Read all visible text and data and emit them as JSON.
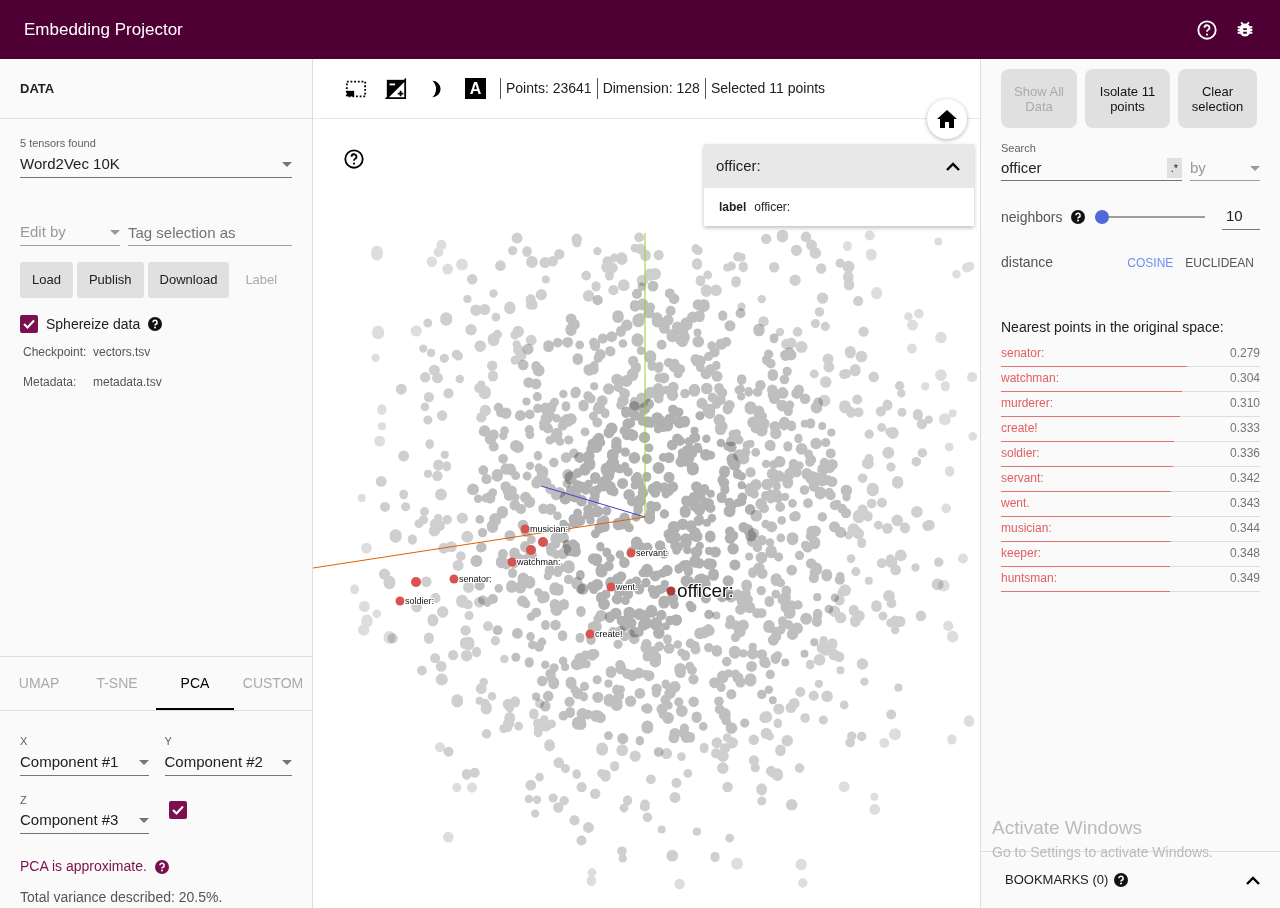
{
  "app": {
    "title": "Embedding Projector"
  },
  "data_panel": {
    "heading": "DATA",
    "tensor_select": {
      "label": "5 tensors found",
      "value": "Word2Vec 10K"
    },
    "edit_by": {
      "placeholder": "Edit by"
    },
    "tag_field": {
      "placeholder": "Tag selection as"
    },
    "buttons": [
      {
        "label": "Load",
        "disabled": false
      },
      {
        "label": "Publish",
        "disabled": false
      },
      {
        "label": "Download",
        "disabled": false
      },
      {
        "label": "Label",
        "disabled": true
      }
    ],
    "sphereize": {
      "label": "Sphereize data",
      "checked": true
    },
    "files": [
      {
        "key": "Checkpoint:",
        "value": "vectors.tsv"
      },
      {
        "key": "Metadata:",
        "value": "metadata.tsv"
      }
    ]
  },
  "projection_tabs": [
    {
      "label": "UMAP",
      "selected": false
    },
    {
      "label": "T-SNE",
      "selected": false
    },
    {
      "label": "PCA",
      "selected": true
    },
    {
      "label": "CUSTOM",
      "selected": false
    }
  ],
  "pca": {
    "x": {
      "label": "X",
      "value": "Component #1"
    },
    "y": {
      "label": "Y",
      "value": "Component #2"
    },
    "z": {
      "label": "Z",
      "value": "Component #3"
    },
    "z_enabled": true,
    "note": "PCA is approximate.",
    "variance": "Total variance described: 20.5%."
  },
  "toolbar": {
    "label_toggle": "A",
    "stats": [
      "Points: 23641",
      "Dimension: 128",
      "Selected 11 points"
    ]
  },
  "canvas": {
    "points": [
      {
        "label": "musician:",
        "kind": "neighbor"
      },
      {
        "label": "servant:",
        "kind": "neighbor"
      },
      {
        "label": "watchman:",
        "kind": "neighbor"
      },
      {
        "label": "senator:",
        "kind": "neighbor"
      },
      {
        "label": "went.",
        "kind": "neighbor"
      },
      {
        "label": "officer:",
        "kind": "focus"
      },
      {
        "label": "soldier:",
        "kind": "neighbor"
      },
      {
        "label": "create!",
        "kind": "neighbor"
      }
    ]
  },
  "inspector_card": {
    "title": "officer:",
    "expanded": true,
    "fields": [
      {
        "key": "label",
        "value": "officer:"
      }
    ]
  },
  "right_panel": {
    "buttons": [
      {
        "label": "Show All Data",
        "disabled": true
      },
      {
        "label": "Isolate 11 points",
        "disabled": false
      },
      {
        "label": "Clear selection",
        "disabled": false
      }
    ],
    "search": {
      "label": "Search",
      "value": "officer",
      "regex": ".*",
      "by_placeholder": "by"
    },
    "neighbors": {
      "label": "neighbors",
      "level": 0.0,
      "value": "10"
    },
    "distance": {
      "label": "distance",
      "options": [
        {
          "label": "COSINE",
          "selected": true
        },
        {
          "label": "EUCLIDEAN",
          "selected": false
        }
      ]
    },
    "nearest_heading": "Nearest points in the original space:",
    "nearest": [
      {
        "label": "senator:",
        "value": "0.279",
        "level": 0.72
      },
      {
        "label": "watchman:",
        "value": "0.304",
        "level": 0.7
      },
      {
        "label": "murderer:",
        "value": "0.310",
        "level": 0.69
      },
      {
        "label": "create!",
        "value": "0.333",
        "level": 0.667
      },
      {
        "label": "soldier:",
        "value": "0.336",
        "level": 0.664
      },
      {
        "label": "servant:",
        "value": "0.342",
        "level": 0.658
      },
      {
        "label": "went.",
        "value": "0.343",
        "level": 0.657
      },
      {
        "label": "musician:",
        "value": "0.344",
        "level": 0.656
      },
      {
        "label": "keeper:",
        "value": "0.348",
        "level": 0.652
      },
      {
        "label": "huntsman:",
        "value": "0.349",
        "level": 0.651
      }
    ],
    "bookmarks": {
      "label": "BOOKMARKS (0)",
      "expanded": false
    }
  },
  "os_notice": {
    "title": "Activate Windows",
    "message": "Go to Settings to activate Windows."
  }
}
